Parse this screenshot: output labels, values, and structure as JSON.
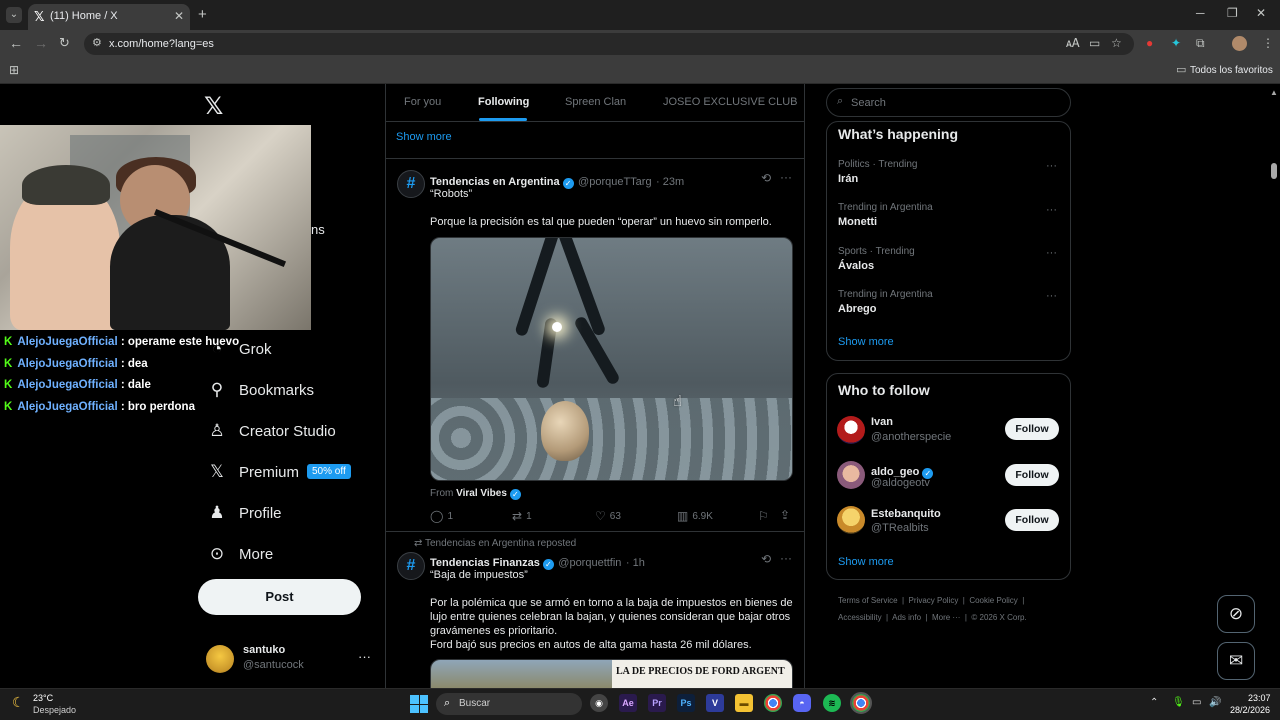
{
  "browser": {
    "tab_title": "(11) Home / X",
    "url": "x.com/home?lang=es",
    "bookmarks_label": "Todos los favoritos"
  },
  "x_nav": {
    "items": [
      {
        "label": "Grok",
        "icon": "grok-icon"
      },
      {
        "label": "Bookmarks",
        "icon": "bookmark-icon"
      },
      {
        "label": "Creator Studio",
        "icon": "creator-studio-icon"
      },
      {
        "label": "Premium",
        "icon": "x-logo-icon"
      },
      {
        "label": "Profile",
        "icon": "person-icon"
      },
      {
        "label": "More",
        "icon": "more-circle-icon"
      }
    ],
    "premium_badge": "50% off",
    "post_label": "Post",
    "peek_text": "ns",
    "account": {
      "name": "santuko",
      "handle": "@santucock"
    }
  },
  "chat_overlay": [
    {
      "user": "AlejoJuegaOfficial",
      "message": ": operame este huevo"
    },
    {
      "user": "AlejoJuegaOfficial",
      "message": ": dea"
    },
    {
      "user": "AlejoJuegaOfficial",
      "message": ": dale"
    },
    {
      "user": "AlejoJuegaOfficial",
      "message": ": bro perdona"
    }
  ],
  "timeline": {
    "tabs": [
      "For you",
      "Following",
      "Spreen Clan",
      "JOSEO EXCLUSIVE CLUB"
    ],
    "active_tab": "Following",
    "show_more": "Show more",
    "tweets": [
      {
        "name": "Tendencias en Argentina",
        "handle": "@porqueTTarg",
        "time": "· 23m",
        "title": "“Robots”",
        "body": "Porque la precisión es tal que pueden “operar” un huevo sin romperlo.",
        "from_label": "From",
        "from_account": "Viral Vibes",
        "replies": "1",
        "reposts": "1",
        "likes": "63",
        "views": "6.9K"
      },
      {
        "repost_note": "Tendencias en Argentina reposted",
        "name": "Tendencias Finanzas",
        "handle": "@porquettfin",
        "time": "· 1h",
        "title": "“Baja de impuestos”",
        "body_lines": [
          "Por la polémica que se armó en torno a la baja de impuestos en bienes de",
          "lujo entre quienes celebran la bajan, y quienes consideran que bajar otros",
          "gravámenes es prioritario.",
          "Ford bajó sus precios en autos de alta gama hasta 26 mil dólares."
        ],
        "image_text": "LA DE PRECIOS DE FORD ARGENT"
      }
    ]
  },
  "sidebar": {
    "search_placeholder": "Search",
    "whats_happening": {
      "title": "What’s happening",
      "trends": [
        {
          "context": "Politics · Trending",
          "name": "Irán"
        },
        {
          "context": "Trending in Argentina",
          "name": "Monetti"
        },
        {
          "context": "Sports · Trending",
          "name": "Ávalos"
        },
        {
          "context": "Trending in Argentina",
          "name": "Abrego"
        }
      ],
      "show_more": "Show more"
    },
    "who_to_follow": {
      "title": "Who to follow",
      "users": [
        {
          "name": "Ivan",
          "handle": "@anotherspecie",
          "verified": false
        },
        {
          "name": "aldo_geo",
          "handle": "@aldogeotv",
          "verified": true
        },
        {
          "name": "Estebanquito",
          "handle": "@TRealbits",
          "verified": false
        }
      ],
      "follow_label": "Follow",
      "show_more": "Show more"
    },
    "footer": {
      "row1": [
        "Terms of Service",
        "Privacy Policy",
        "Cookie Policy"
      ],
      "row2": [
        "Accessibility",
        "Ads info",
        "More ···",
        "© 2026 X Corp."
      ]
    }
  },
  "taskbar": {
    "weather_temp": "23°C",
    "weather_desc": "Despejado",
    "search_placeholder": "Buscar",
    "time": "23:07",
    "date": "28/2/2026",
    "apps": [
      "Ae",
      "Pr",
      "Ps",
      "V"
    ]
  },
  "colors": {
    "accent": "#1d9bf0",
    "kick_green": "#53fc18",
    "background": "#000000"
  }
}
